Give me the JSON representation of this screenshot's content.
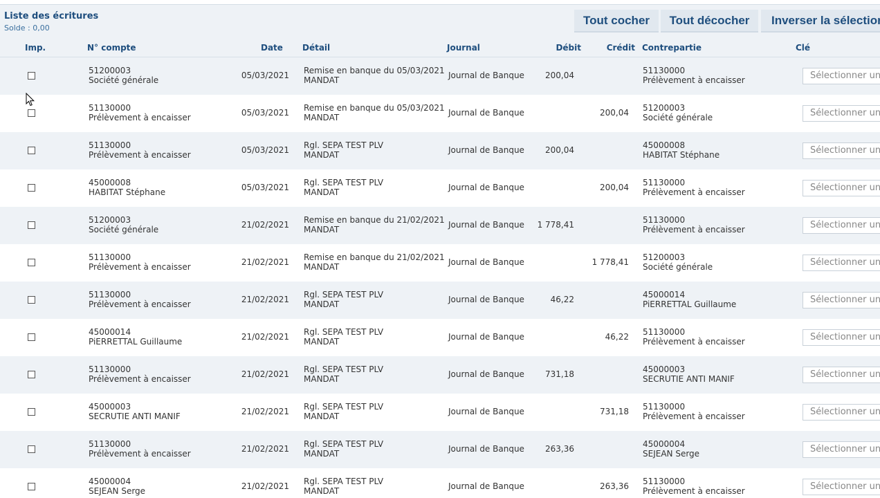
{
  "header": {
    "title": "Liste des écritures",
    "balance": "Solde : 0,00",
    "buttons": {
      "check_all": "Tout cocher",
      "uncheck_all": "Tout décocher",
      "invert": "Inverser la sélection"
    }
  },
  "columns": {
    "imp": "Imp.",
    "compte": "N° compte",
    "date": "Date",
    "detail": "Détail",
    "journal": "Journal",
    "debit": "Débit",
    "credit": "Crédit",
    "contrepartie": "Contrepartie",
    "cle": "Clé"
  },
  "select_placeholder": "Sélectionner une clé",
  "rows": [
    {
      "account_num": "51200003",
      "account_name": "Société générale",
      "date": "05/03/2021",
      "detail1": "Remise en banque du 05/03/2021",
      "detail2": "MANDAT",
      "journal": "Journal de Banque",
      "debit": "200,04",
      "credit": "",
      "contra_num": "51130000",
      "contra_name": "Prélèvement à encaisser"
    },
    {
      "account_num": "51130000",
      "account_name": "Prélèvement à encaisser",
      "date": "05/03/2021",
      "detail1": "Remise en banque du 05/03/2021",
      "detail2": "MANDAT",
      "journal": "Journal de Banque",
      "debit": "",
      "credit": "200,04",
      "contra_num": "51200003",
      "contra_name": "Société générale"
    },
    {
      "account_num": "51130000",
      "account_name": "Prélèvement à encaisser",
      "date": "05/03/2021",
      "detail1": "Rgl. SEPA TEST PLV",
      "detail2": "MANDAT",
      "journal": "Journal de Banque",
      "debit": "200,04",
      "credit": "",
      "contra_num": "45000008",
      "contra_name": "HABITAT Stéphane"
    },
    {
      "account_num": "45000008",
      "account_name": "HABITAT Stéphane",
      "date": "05/03/2021",
      "detail1": "Rgl. SEPA TEST PLV",
      "detail2": "MANDAT",
      "journal": "Journal de Banque",
      "debit": "",
      "credit": "200,04",
      "contra_num": "51130000",
      "contra_name": "Prélèvement à encaisser"
    },
    {
      "account_num": "51200003",
      "account_name": "Société générale",
      "date": "21/02/2021",
      "detail1": "Remise en banque du 21/02/2021",
      "detail2": "MANDAT",
      "journal": "Journal de Banque",
      "debit": "1 778,41",
      "credit": "",
      "contra_num": "51130000",
      "contra_name": "Prélèvement à encaisser"
    },
    {
      "account_num": "51130000",
      "account_name": "Prélèvement à encaisser",
      "date": "21/02/2021",
      "detail1": "Remise en banque du 21/02/2021",
      "detail2": "MANDAT",
      "journal": "Journal de Banque",
      "debit": "",
      "credit": "1 778,41",
      "contra_num": "51200003",
      "contra_name": "Société générale"
    },
    {
      "account_num": "51130000",
      "account_name": "Prélèvement à encaisser",
      "date": "21/02/2021",
      "detail1": "Rgl. SEPA TEST PLV",
      "detail2": "MANDAT",
      "journal": "Journal de Banque",
      "debit": "46,22",
      "credit": "",
      "contra_num": "45000014",
      "contra_name": "PiERRETTAL Guillaume"
    },
    {
      "account_num": "45000014",
      "account_name": "PiERRETTAL Guillaume",
      "date": "21/02/2021",
      "detail1": "Rgl. SEPA TEST PLV",
      "detail2": "MANDAT",
      "journal": "Journal de Banque",
      "debit": "",
      "credit": "46,22",
      "contra_num": "51130000",
      "contra_name": "Prélèvement à encaisser"
    },
    {
      "account_num": "51130000",
      "account_name": "Prélèvement à encaisser",
      "date": "21/02/2021",
      "detail1": "Rgl. SEPA TEST PLV",
      "detail2": "MANDAT",
      "journal": "Journal de Banque",
      "debit": "731,18",
      "credit": "",
      "contra_num": "45000003",
      "contra_name": "SECRUTIE ANTI MANIF"
    },
    {
      "account_num": "45000003",
      "account_name": "SECRUTIE ANTI MANIF",
      "date": "21/02/2021",
      "detail1": "Rgl. SEPA TEST PLV",
      "detail2": "MANDAT",
      "journal": "Journal de Banque",
      "debit": "",
      "credit": "731,18",
      "contra_num": "51130000",
      "contra_name": "Prélèvement à encaisser"
    },
    {
      "account_num": "51130000",
      "account_name": "Prélèvement à encaisser",
      "date": "21/02/2021",
      "detail1": "Rgl. SEPA TEST PLV",
      "detail2": "MANDAT",
      "journal": "Journal de Banque",
      "debit": "263,36",
      "credit": "",
      "contra_num": "45000004",
      "contra_name": "SEJEAN Serge"
    },
    {
      "account_num": "45000004",
      "account_name": "SEJEAN Serge",
      "date": "21/02/2021",
      "detail1": "Rgl. SEPA TEST PLV",
      "detail2": "MANDAT",
      "journal": "Journal de Banque",
      "debit": "",
      "credit": "263,36",
      "contra_num": "51130000",
      "contra_name": "Prélèvement à encaisser"
    }
  ]
}
